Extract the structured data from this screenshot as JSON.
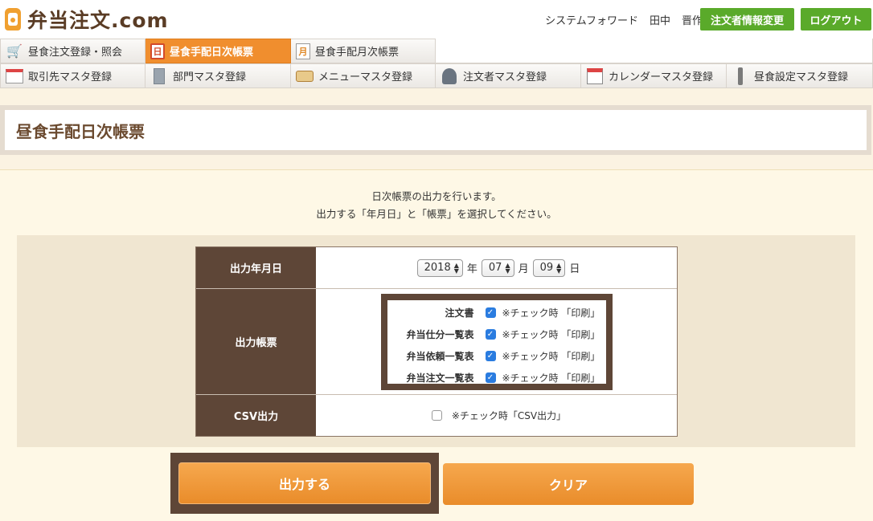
{
  "header": {
    "logo_text": "弁当注文.com",
    "links": [
      "システムフォワード",
      "田中",
      "晋作"
    ],
    "profile_button": "注文者情報変更",
    "logout_button": "ログアウト"
  },
  "nav": {
    "row1": [
      {
        "label": "昼食注文登録・照会",
        "icon": "cart-icon"
      },
      {
        "label": "昼食手配日次帳票",
        "icon": "daily-report-icon",
        "active": true
      },
      {
        "label": "昼食手配月次帳票",
        "icon": "monthly-report-icon"
      }
    ],
    "row2": [
      {
        "label": "取引先マスタ登録",
        "icon": "client-icon"
      },
      {
        "label": "部門マスタ登録",
        "icon": "building-icon"
      },
      {
        "label": "メニューマスタ登録",
        "icon": "bento-icon"
      },
      {
        "label": "注文者マスタ登録",
        "icon": "user-icon"
      },
      {
        "label": "カレンダーマスタ登録",
        "icon": "calendar-icon"
      },
      {
        "label": "昼食設定マスタ登録",
        "icon": "wrench-icon"
      }
    ]
  },
  "page_title": "昼食手配日次帳票",
  "intro": {
    "line1": "日次帳票の出力を行います。",
    "line2": "出力する「年月日」と「帳票」を選択してください。"
  },
  "form": {
    "date_label": "出力年月日",
    "year": "2018",
    "year_suffix": "年",
    "month": "07",
    "month_suffix": "月",
    "day": "09",
    "day_suffix": "日",
    "reports_label": "出力帳票",
    "reports": [
      {
        "name": "注文書",
        "checked": true,
        "note": "※チェック時 「印刷」"
      },
      {
        "name": "弁当仕分一覧表",
        "checked": true,
        "note": "※チェック時 「印刷」"
      },
      {
        "name": "弁当依頼一覧表",
        "checked": true,
        "note": "※チェック時 「印刷」"
      },
      {
        "name": "弁当注文一覧表",
        "checked": true,
        "note": "※チェック時 「印刷」"
      }
    ],
    "csv_label": "CSV出力",
    "csv_checked": false,
    "csv_note": "※チェック時「CSV出力」"
  },
  "buttons": {
    "output": "出力する",
    "clear": "クリア"
  },
  "colors": {
    "brand_brown": "#5e4637",
    "accent_orange": "#f08e2e",
    "header_green": "#5aaa2a",
    "checkbox_blue": "#2a7ce0"
  }
}
